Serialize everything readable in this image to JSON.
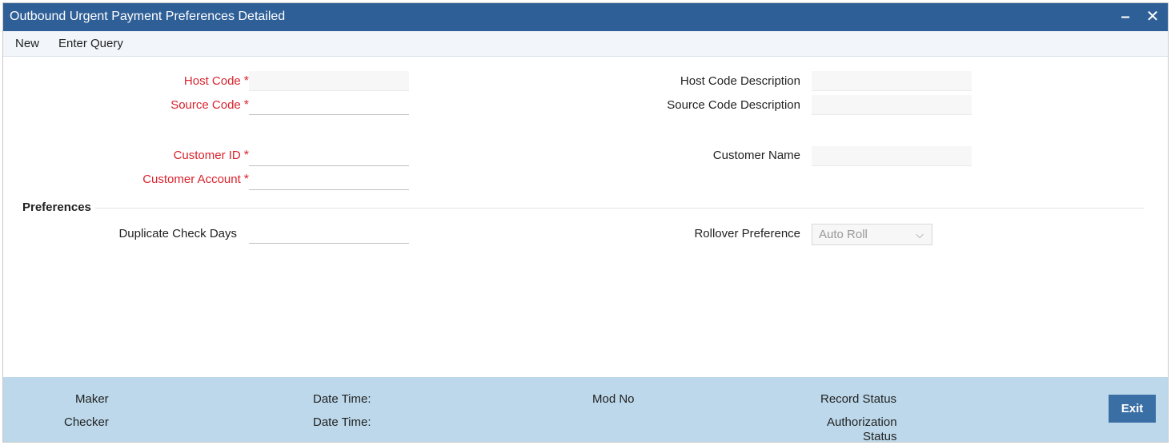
{
  "window": {
    "title": "Outbound Urgent Payment Preferences Detailed",
    "minimize_glyph": "–",
    "close_glyph": "✕"
  },
  "menu": {
    "new_label": "New",
    "enter_query_label": "Enter Query"
  },
  "form": {
    "host_code_label": "Host Code",
    "host_code_value": "",
    "source_code_label": "Source Code",
    "source_code_value": "",
    "host_code_desc_label": "Host Code Description",
    "host_code_desc_value": "",
    "source_code_desc_label": "Source Code Description",
    "source_code_desc_value": "",
    "customer_id_label": "Customer ID",
    "customer_id_value": "",
    "customer_account_label": "Customer Account",
    "customer_account_value": "",
    "customer_name_label": "Customer Name",
    "customer_name_value": "",
    "required_marker": "*"
  },
  "preferences": {
    "section_title": "Preferences",
    "duplicate_check_days_label": "Duplicate Check Days",
    "duplicate_check_days_value": "",
    "rollover_preference_label": "Rollover Preference",
    "rollover_preference_value": "Auto Roll"
  },
  "footer": {
    "maker_label": "Maker",
    "checker_label": "Checker",
    "date_time_label_1": "Date Time:",
    "date_time_label_2": "Date Time:",
    "mod_no_label": "Mod No",
    "record_status_label": "Record Status",
    "authorization_status_line1": "Authorization",
    "authorization_status_line2": "Status",
    "exit_label": "Exit"
  },
  "colors": {
    "titlebar": "#2f5f97",
    "required_label": "#d9232d",
    "footer_bg": "#bcd8ea",
    "exit_button": "#3a6fa6"
  }
}
